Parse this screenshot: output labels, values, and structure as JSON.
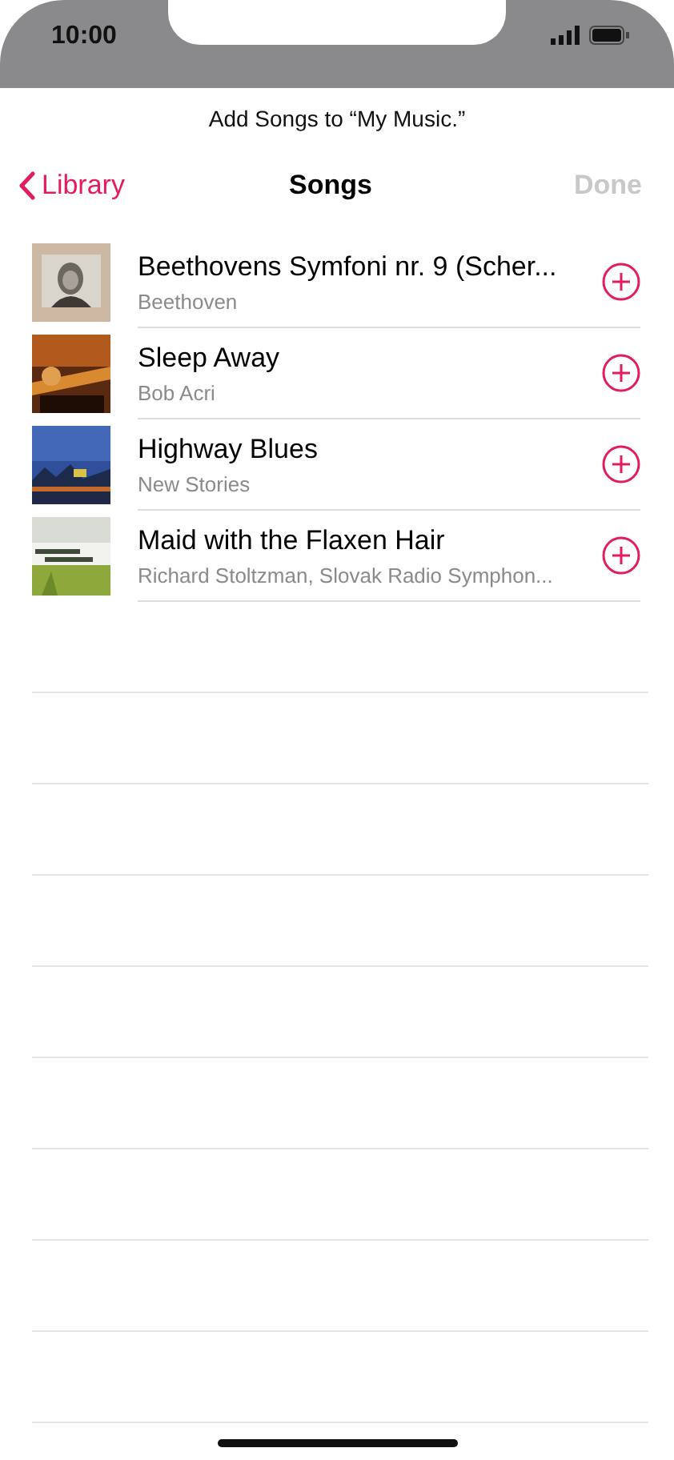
{
  "status_bar": {
    "time": "10:00"
  },
  "sheet": {
    "prompt": "Add Songs to “My Music.”"
  },
  "nav": {
    "back": "Library",
    "title": "Songs",
    "done": {
      "label": "Done",
      "disabled": true
    }
  },
  "songs": [
    {
      "title": "Beethovens Symfoni nr. 9 (Scher...",
      "artist": "Beethoven"
    },
    {
      "title": "Sleep Away",
      "artist": "Bob Acri"
    },
    {
      "title": "Highway Blues",
      "artist": "New Stories"
    },
    {
      "title": "Maid with the Flaxen Hair",
      "artist": "Richard Stoltzman, Slovak Radio Symphon..."
    }
  ]
}
